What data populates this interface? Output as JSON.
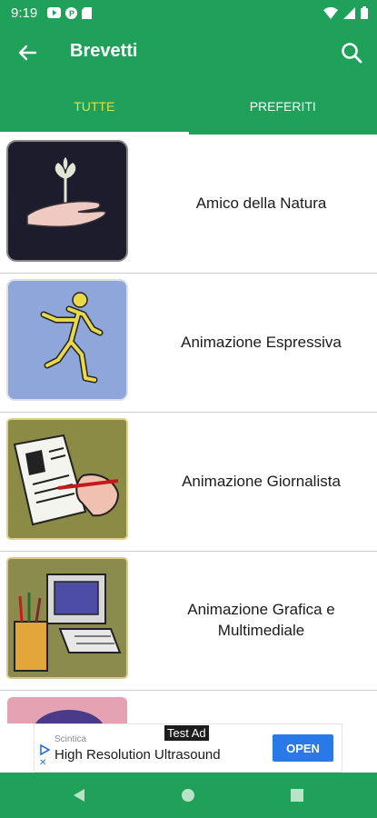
{
  "status_bar": {
    "time": "9:19"
  },
  "toolbar": {
    "title": "Brevetti"
  },
  "tabs": [
    {
      "label": "TUTTE",
      "selected": true
    },
    {
      "label": "PREFERITI",
      "selected": false
    }
  ],
  "items": [
    {
      "label": "Amico della Natura",
      "icon": "hand-with-sprout-icon"
    },
    {
      "label": "Animazione Espressiva",
      "icon": "dancing-figure-icon"
    },
    {
      "label": "Animazione Giornalista",
      "icon": "newspaper-writing-icon"
    },
    {
      "label": "Animazione Grafica e Multimediale",
      "icon": "computer-with-pencils-icon"
    }
  ],
  "ad": {
    "badge": "Test Ad",
    "sponsor": "Scintica",
    "headline": "High Resolution Ultrasound",
    "cta": "OPEN"
  },
  "colors": {
    "primary": "#1fa15a",
    "tab_selected_text": "#e6df3c",
    "ad_button": "#2a79e8"
  }
}
